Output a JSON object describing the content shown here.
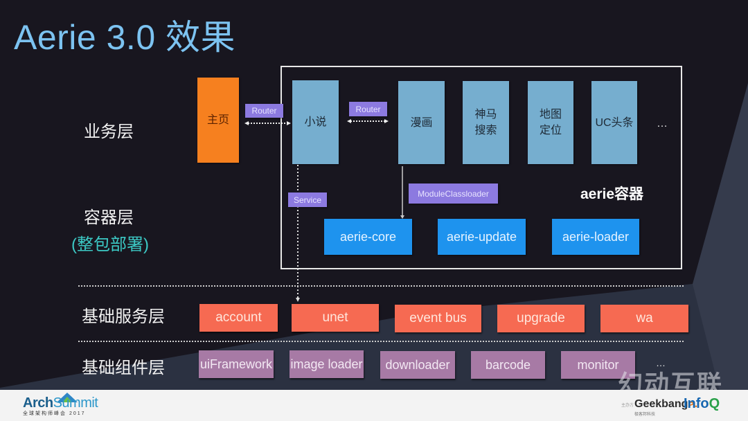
{
  "slide": {
    "title": "Aerie 3.0 效果"
  },
  "layers": {
    "business": "业务层",
    "container": "容器层",
    "container_note": "(整包部署)",
    "base_service": "基础服务层",
    "base_component": "基础组件层"
  },
  "business_modules": [
    {
      "label": "主页",
      "role": "host"
    },
    {
      "label": "小说"
    },
    {
      "label": "漫画"
    },
    {
      "label": "神马\n搜索"
    },
    {
      "label": "地图\n定位"
    },
    {
      "label": "UC头条"
    }
  ],
  "business_more": "…",
  "connectors": {
    "router_1": "Router",
    "router_2": "Router",
    "service": "Service",
    "module_classloader": "ModuleClassloader"
  },
  "container": {
    "title": "aerie容器",
    "modules": [
      "aerie-core",
      "aerie-update",
      "aerie-loader"
    ]
  },
  "base_services": [
    "account",
    "unet",
    "event bus",
    "upgrade",
    "wa"
  ],
  "base_components": [
    "uiFramework",
    "image loader",
    "downloader",
    "barcode",
    "monitor"
  ],
  "base_components_more": "…",
  "colors": {
    "title": "#7cc3f1",
    "host_module": "#f6801f",
    "business_module": "#76aecf",
    "connector": "#8c7ae0",
    "container_module": "#1e93ee",
    "base_service": "#f66a52",
    "base_component": "#a77aa5",
    "note": "#3cc9c5"
  },
  "footer": {
    "left_logo_main": "Arch",
    "left_logo_accent": "Summit",
    "left_logo_sub": "全球架构师峰会 2017",
    "host_label": "主办方",
    "right_logo_1_main": "Geekbang",
    "right_logo_1_accent": ">.",
    "right_logo_1_sub": "极客邦科技",
    "right_logo_2_main": "Info",
    "right_logo_2_accent": "Q"
  },
  "watermark": "幻动互联"
}
